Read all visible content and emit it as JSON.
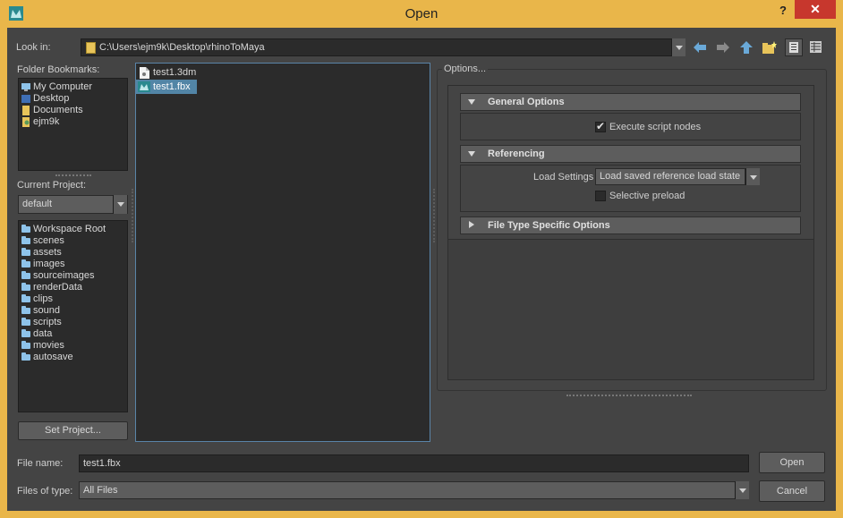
{
  "window": {
    "title": "Open",
    "help_label": "?",
    "close_label": "✕"
  },
  "look_in": {
    "label": "Look in:",
    "path": "C:\\Users\\ejm9k\\Desktop\\rhinoToMaya"
  },
  "bookmarks": {
    "label": "Folder Bookmarks:",
    "items": [
      {
        "label": "My Computer",
        "icon": "computer-icon"
      },
      {
        "label": "Desktop",
        "icon": "desktop-icon"
      },
      {
        "label": "Documents",
        "icon": "documents-icon"
      },
      {
        "label": "ejm9k",
        "icon": "user-folder-icon"
      }
    ]
  },
  "project": {
    "label": "Current Project:",
    "value": "default",
    "folders": [
      "Workspace Root",
      "scenes",
      "assets",
      "images",
      "sourceimages",
      "renderData",
      "clips",
      "sound",
      "scripts",
      "data",
      "movies",
      "autosave"
    ],
    "set_project_label": "Set Project..."
  },
  "files": {
    "items": [
      {
        "label": "test1.3dm",
        "icon": "document-icon",
        "selected": false
      },
      {
        "label": "test1.fbx",
        "icon": "maya-file-icon",
        "selected": true
      }
    ]
  },
  "options": {
    "label": "Options...",
    "general": {
      "header": "General Options",
      "execute_script_nodes": "Execute script nodes",
      "execute_checked": true
    },
    "referencing": {
      "header": "Referencing",
      "load_settings_label": "Load Settings",
      "load_settings_value": "Load saved reference load state",
      "selective_preload": "Selective preload",
      "selective_checked": false
    },
    "file_type": {
      "header": "File Type Specific Options"
    }
  },
  "footer": {
    "file_name_label": "File name:",
    "file_name_value": "test1.fbx",
    "files_of_type_label": "Files of type:",
    "files_of_type_value": "All Files",
    "open_label": "Open",
    "cancel_label": "Cancel"
  },
  "colors": {
    "titlebar": "#e9b64a",
    "close_button": "#c7372d",
    "panel_bg": "#444444",
    "list_bg": "#2b2b2b",
    "selection": "#5285a6",
    "folder_icon": "#8ec3ea"
  }
}
